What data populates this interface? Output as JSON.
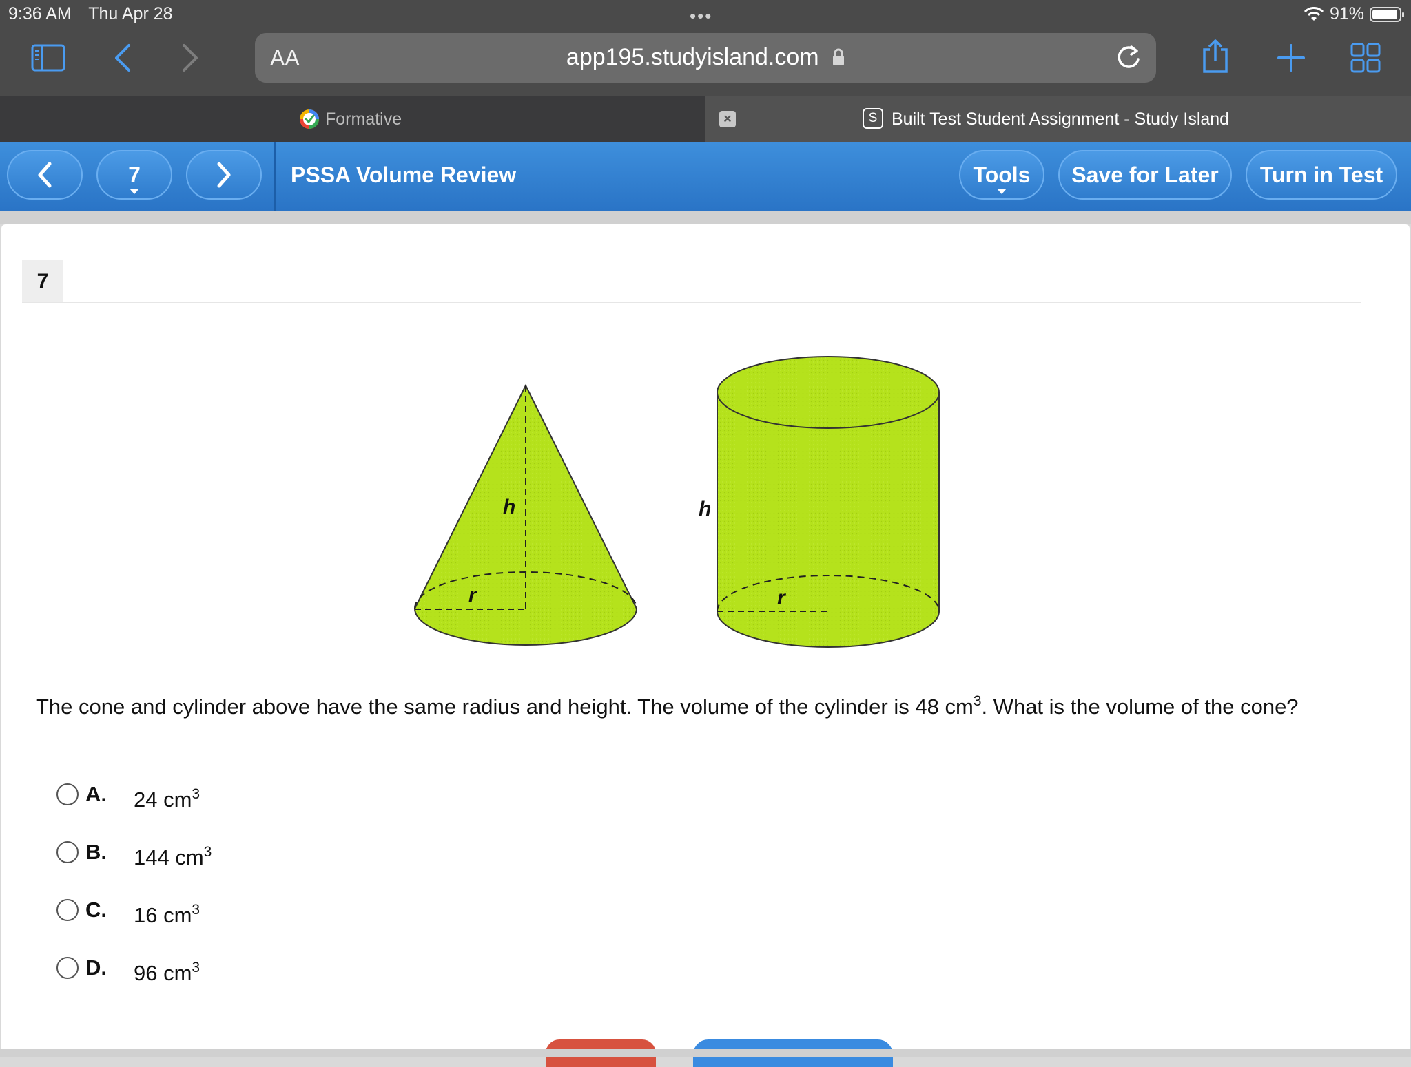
{
  "status_bar": {
    "time": "9:36 AM",
    "date": "Thu Apr 28",
    "battery": "91%"
  },
  "browser": {
    "text_size_label": "AA",
    "url": "app195.studyisland.com",
    "tabs": [
      {
        "label": "Formative",
        "active": false
      },
      {
        "label": "Built Test Student Assignment - Study Island",
        "active": true,
        "favicon_letter": "S"
      }
    ]
  },
  "header": {
    "question_selector": "7",
    "title": "PSSA Volume Review",
    "tools_label": "Tools",
    "save_label": "Save for Later",
    "turn_in_label": "Turn in Test"
  },
  "question": {
    "number": "7",
    "figure": {
      "height_label": "h",
      "radius_label": "r",
      "fill_color": "#b5e21c"
    },
    "text_before": "The cone and cylinder above have the same radius and height. The volume of the cylinder is 48 cm",
    "text_sup": "3",
    "text_after": ". What is the volume of the cone?",
    "answers": [
      {
        "letter": "A.",
        "value": "24 cm",
        "sup": "3"
      },
      {
        "letter": "B.",
        "value": "144 cm",
        "sup": "3"
      },
      {
        "letter": "C.",
        "value": "16 cm",
        "sup": "3"
      },
      {
        "letter": "D.",
        "value": "96 cm",
        "sup": "3"
      }
    ]
  },
  "colors": {
    "header_blue": "#2f7ccd",
    "chrome_gray": "#4a4a4a",
    "accent_icon": "#4a9bf0"
  }
}
